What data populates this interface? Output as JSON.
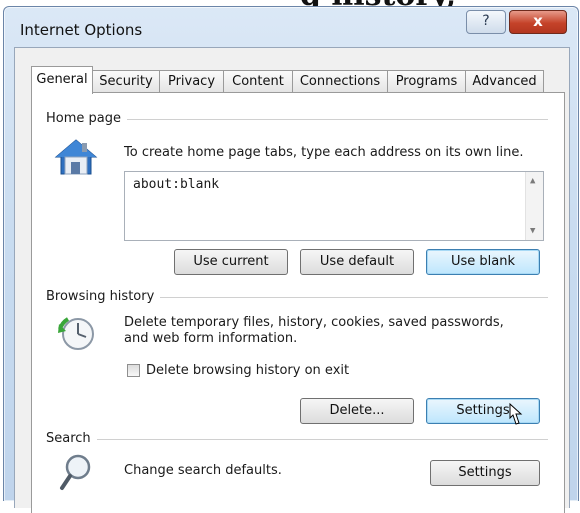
{
  "cropped_caption": "g history,",
  "window": {
    "title": "Internet Options",
    "help_label": "?",
    "close_label": "x"
  },
  "tabs": [
    {
      "label": "General",
      "active": true
    },
    {
      "label": "Security",
      "active": false
    },
    {
      "label": "Privacy",
      "active": false
    },
    {
      "label": "Content",
      "active": false
    },
    {
      "label": "Connections",
      "active": false
    },
    {
      "label": "Programs",
      "active": false
    },
    {
      "label": "Advanced",
      "active": false
    }
  ],
  "home_page": {
    "group_label": "Home page",
    "description": "To create home page tabs, type each address on its own line.",
    "url_value": "about:blank",
    "use_current_label": "Use current",
    "use_default_label": "Use default",
    "use_blank_label": "Use blank",
    "icon": "house-icon"
  },
  "browsing_history": {
    "group_label": "Browsing history",
    "description_line1": "Delete temporary files, history, cookies, saved passwords,",
    "description_line2": "and web form information.",
    "checkbox_label": "Delete browsing history on exit",
    "checkbox_checked": false,
    "delete_label": "Delete...",
    "settings_label": "Settings",
    "icon": "history-clock-icon"
  },
  "search": {
    "group_label": "Search",
    "description": "Change search defaults.",
    "settings_label": "Settings",
    "icon": "magnifier-icon"
  },
  "colors": {
    "focus_button": "#bee6fd",
    "close_button": "#c5432a"
  }
}
